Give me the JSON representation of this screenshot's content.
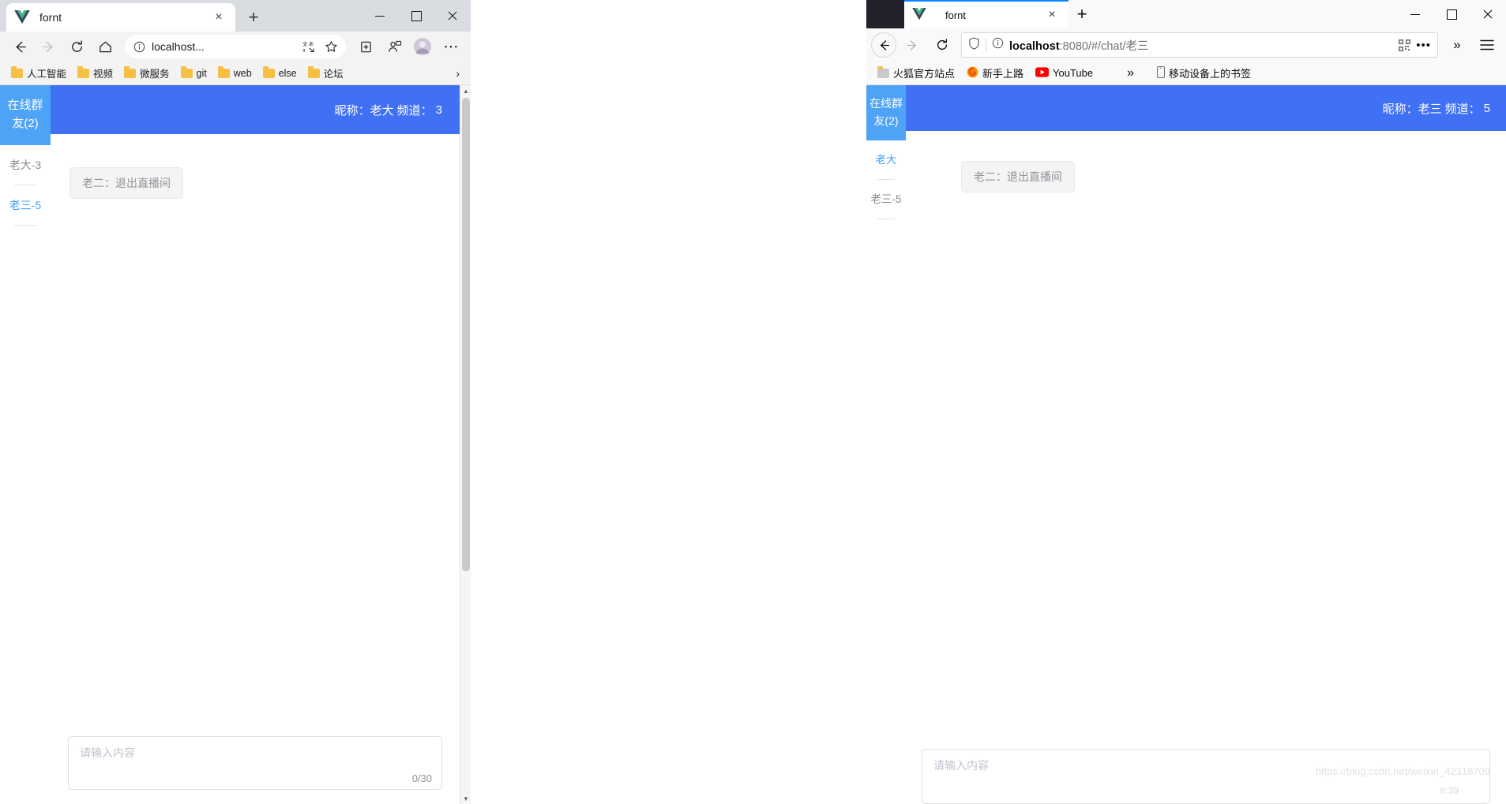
{
  "edge_window": {
    "tab": {
      "title": "fornt",
      "favicon": "vue-logo-icon",
      "close_label": "×"
    },
    "new_tab_label": "+",
    "window_controls": {
      "minimize": "–",
      "maximize": "□",
      "close": "×"
    },
    "toolbar": {
      "back": "←",
      "forward": "→",
      "refresh": "↻",
      "home": "⌂",
      "site_info": "ⓘ",
      "url": "localhost...",
      "translate": "translate-icon",
      "favorite": "☆",
      "collections": "collections-icon",
      "profile": "profile-icon",
      "avatar": "avatar-icon",
      "more": "⋯"
    },
    "bookmarks": [
      {
        "label": "人工智能"
      },
      {
        "label": "视频"
      },
      {
        "label": "微服务"
      },
      {
        "label": "git"
      },
      {
        "label": "web"
      },
      {
        "label": "else"
      },
      {
        "label": "论坛"
      }
    ],
    "bookmark_overflow": "›"
  },
  "edge_app": {
    "sidebar": {
      "title": "在线群友(2)",
      "users": [
        {
          "label": "老大-3",
          "active": false
        },
        {
          "label": "老三-5",
          "active": true
        }
      ]
    },
    "header": {
      "nickname_label": "昵称：老大",
      "channel_label": "频道：",
      "channel_value": "3"
    },
    "messages": [
      {
        "text": "老二：退出直播间"
      }
    ],
    "input": {
      "placeholder": "请输入内容",
      "value": "",
      "counter": "0/30"
    }
  },
  "firefox_window": {
    "tab": {
      "title": "fornt",
      "favicon": "vue-logo-icon",
      "close_label": "×"
    },
    "new_tab_label": "+",
    "window_controls": {
      "minimize": "–",
      "maximize": "□",
      "close": "×"
    },
    "toolbar": {
      "back": "←",
      "forward": "→",
      "refresh": "↻",
      "shield": "shield-icon",
      "site_info": "ⓘ",
      "url_host": "localhost",
      "url_path": ":8080/#/chat/老三",
      "qr": "qr-code-icon",
      "page_actions": "•••",
      "overflow": "»",
      "menu": "☰"
    },
    "bookmarks": [
      {
        "label": "火狐官方站点",
        "icon": "folder-icon"
      },
      {
        "label": "新手上路",
        "icon": "firefox-icon"
      },
      {
        "label": "YouTube",
        "icon": "youtube-icon"
      }
    ],
    "bookmarks_overflow": "»",
    "mobile_bookmarks": {
      "label": "移动设备上的书签",
      "icon": "mobile-icon"
    }
  },
  "firefox_app": {
    "sidebar": {
      "title": "在线群友(2)",
      "users": [
        {
          "label": "老大",
          "active": true
        },
        {
          "label": "老三-5",
          "active": false
        }
      ]
    },
    "header": {
      "nickname_label": "昵称：老三",
      "channel_label": "频道：",
      "channel_value": "5"
    },
    "messages": [
      {
        "text": "老二：退出直播间"
      }
    ],
    "input": {
      "placeholder": "请输入内容",
      "value": ""
    },
    "watermark": "https://blog.csdn.net/weixin_42318709",
    "watermark_time": "8:39"
  },
  "colors": {
    "app_header_blue": "#4070f4",
    "sidebar_blue": "#4fa3f7",
    "active_link": "#409eff",
    "bubble_bg": "#f4f4f5"
  }
}
